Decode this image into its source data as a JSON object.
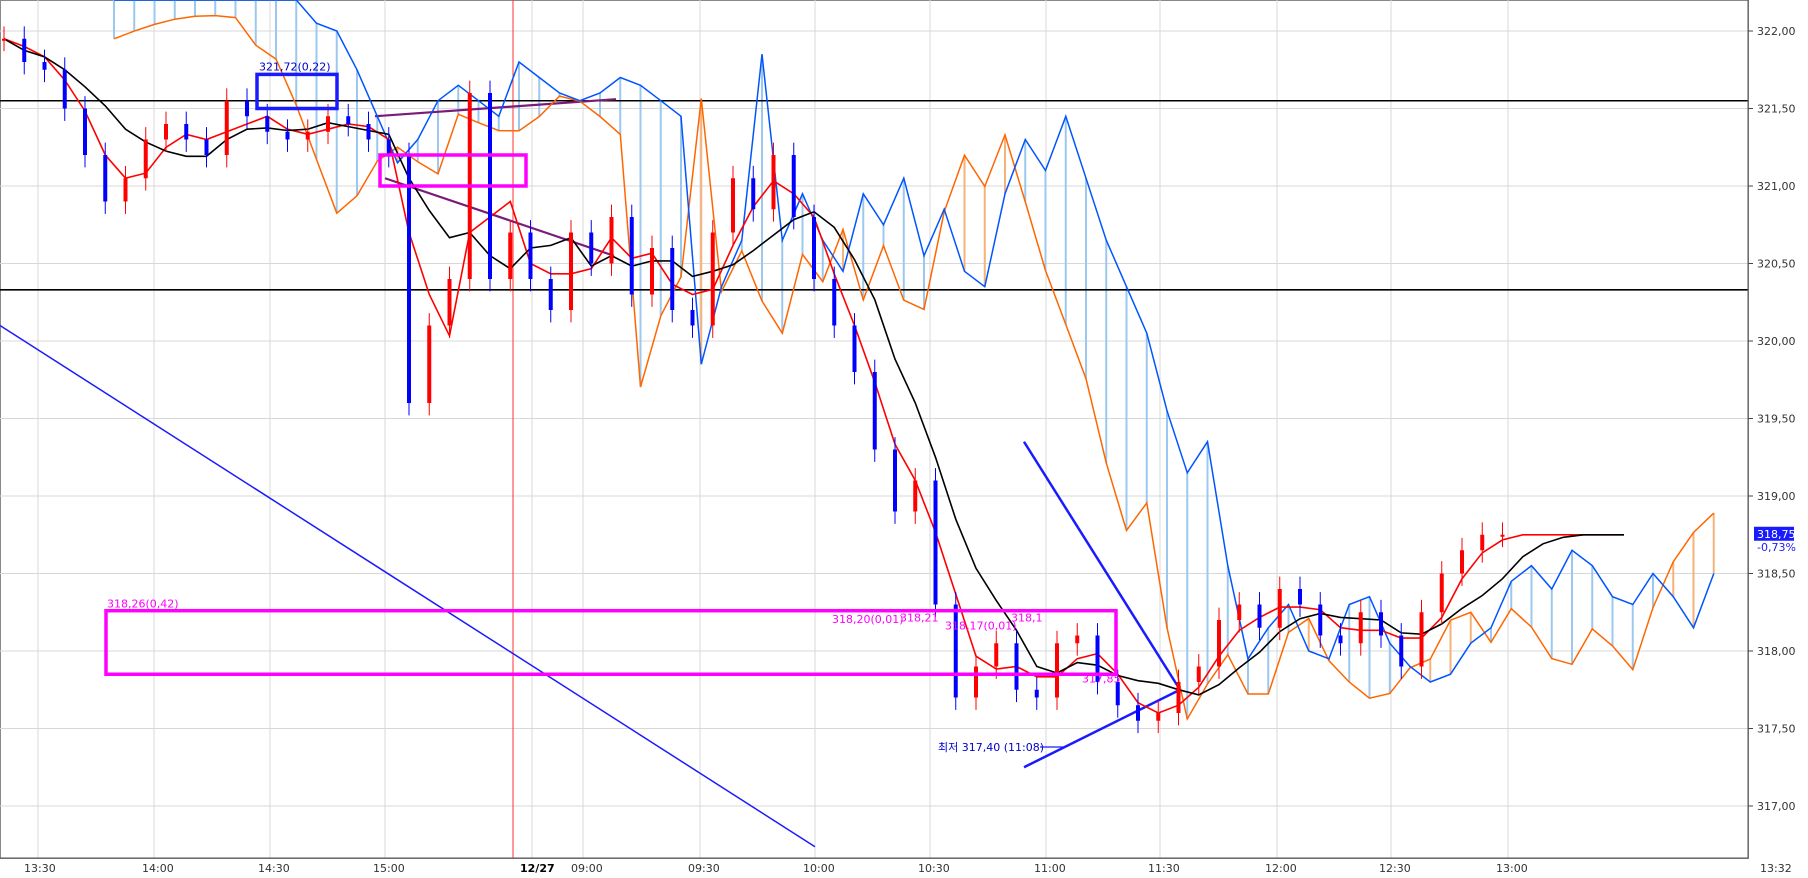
{
  "chart_data": {
    "type": "candlestick",
    "title": "",
    "xlabel": "",
    "ylabel": "",
    "ylim": [
      316.75,
      322.25
    ],
    "grid": true,
    "y_ticks": [
      "322,00",
      "321,50",
      "321,00",
      "320,50",
      "320,00",
      "319,50",
      "319,00",
      "318,50",
      "318,00",
      "317,50",
      "317,00"
    ],
    "y_tick_values": [
      322.0,
      321.5,
      321.0,
      320.5,
      320.0,
      319.5,
      319.0,
      318.5,
      318.0,
      317.5,
      317.0
    ],
    "x_ticks": [
      "13:30",
      "14:00",
      "14:30",
      "15:00",
      "12/27",
      "09:00",
      "09:30",
      "10:00",
      "10:30",
      "11:00",
      "11:30",
      "12:00",
      "12:30",
      "13:00",
      "13:32"
    ],
    "session_divider_label": "12/27",
    "horizontal_lines": [
      321.55,
      320.33
    ],
    "last_price": {
      "value": "318,75",
      "change": "-0,73%"
    },
    "annotations": [
      {
        "text": "321,72(0,22)",
        "color": "#0000cc"
      },
      {
        "text": "318,26(0,42)",
        "color": "#ff00ff"
      },
      {
        "text": "318,20(0,01)",
        "color": "#ff00ff"
      },
      {
        "text": "318,21",
        "color": "#ff00ff"
      },
      {
        "text": "318,17(0,01)",
        "color": "#ff00ff"
      },
      {
        "text": "318,1",
        "color": "#ff00ff"
      },
      {
        "text": "317,85",
        "color": "#ff00ff"
      },
      {
        "text": "최저 317,40 (11:08)",
        "color": "#0000cc"
      }
    ],
    "series": [
      {
        "name": "",
        "style": "candles",
        "up_color": "#ff0000",
        "down_color": "#0000ff",
        "x": [
          0,
          5,
          10,
          15,
          20,
          25,
          30,
          35,
          40,
          45,
          50,
          55,
          60,
          65,
          70,
          75,
          80,
          85,
          90,
          95,
          100,
          105,
          110,
          115,
          120,
          125,
          130,
          135,
          140,
          145,
          150,
          155,
          160,
          165,
          170,
          175,
          180,
          185,
          190,
          195,
          200,
          205,
          210,
          215,
          220,
          225,
          230,
          235,
          240,
          245,
          250,
          255,
          260,
          265,
          270,
          275,
          280,
          285,
          290,
          295,
          300,
          305,
          310,
          315,
          320,
          325,
          330,
          335,
          340,
          345,
          350,
          355,
          360,
          365,
          370,
          375,
          380,
          385,
          390,
          395,
          400
        ],
        "y": [
          321.95,
          321.8,
          321.75,
          321.5,
          321.2,
          320.9,
          321.05,
          321.3,
          321.4,
          321.3,
          321.2,
          321.55,
          321.45,
          321.35,
          321.3,
          321.35,
          321.45,
          321.4,
          321.3,
          321.2,
          319.6,
          320.1,
          320.4,
          321.6,
          320.4,
          320.7,
          320.4,
          320.2,
          320.7,
          320.5,
          320.8,
          320.3,
          320.6,
          320.2,
          320.1,
          320.7,
          321.05,
          320.85,
          321.2,
          320.8,
          320.4,
          320.1,
          319.8,
          319.3,
          318.9,
          319.1,
          318.3,
          317.7,
          317.9,
          318.05,
          317.75,
          317.7,
          318.05,
          318.1,
          317.8,
          317.65,
          317.55,
          317.6,
          317.8,
          317.9,
          318.2,
          318.3,
          318.15,
          318.4,
          318.3,
          318.1,
          318.05,
          318.25,
          318.1,
          317.9,
          318.25,
          318.5,
          318.65,
          318.75,
          318.75,
          318.75,
          318.75,
          318.75,
          318.75,
          318.75,
          318.75
        ]
      },
      {
        "name": "",
        "color": "#ff0000",
        "style": "line"
      },
      {
        "name": "",
        "color": "#000000",
        "style": "line"
      },
      {
        "name": "",
        "color": "#ff6600",
        "style": "line"
      },
      {
        "name": "",
        "color": "#0055ff",
        "style": "line"
      }
    ]
  }
}
